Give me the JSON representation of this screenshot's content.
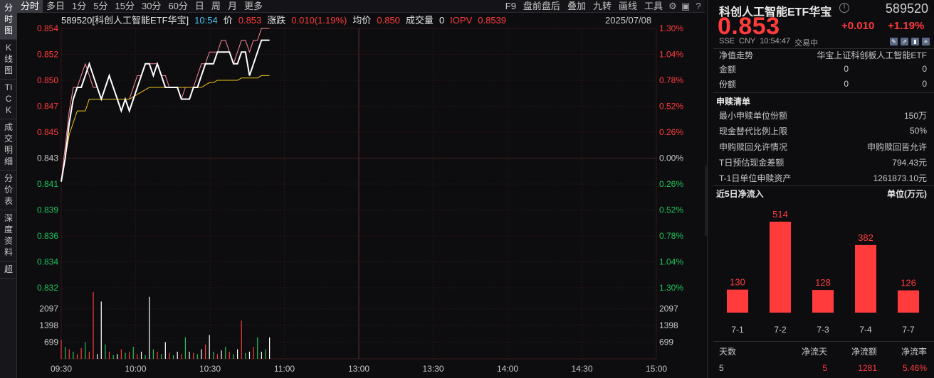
{
  "left_tabs": [
    "分时图",
    "K线图",
    "TICK",
    "成交明细",
    "分价表",
    "深度资料",
    "超"
  ],
  "toolbar": {
    "periods": [
      "分时",
      "多日",
      "1分",
      "5分",
      "15分",
      "30分",
      "60分",
      "日",
      "周",
      "月",
      "更多"
    ],
    "active_period": "分时",
    "right_items": [
      "F9",
      "盘前盘后",
      "叠加",
      "九转",
      "画线",
      "工具"
    ]
  },
  "info": {
    "code_name": "589520[科创人工智能ETF华宝]",
    "time": "10:54",
    "price_label": "价",
    "price": "0.853",
    "change_label": "涨跌",
    "change": "0.010(1.19%)",
    "avg_label": "均价",
    "avg": "0.850",
    "volume_label": "成交量",
    "volume": "0",
    "iopv_label": "IOPV",
    "iopv": "0.8539",
    "date": "2025/07/08"
  },
  "chart_data": {
    "type": "line",
    "y_price_ticks": [
      "0.854",
      "0.852",
      "0.850",
      "0.847",
      "0.845",
      "0.843",
      "0.841",
      "0.839",
      "0.836",
      "0.834",
      "0.832"
    ],
    "y_pct_ticks": [
      "1.30%",
      "1.04%",
      "0.78%",
      "0.52%",
      "0.26%",
      "0.00%",
      "0.26%",
      "0.52%",
      "0.78%",
      "1.04%",
      "1.30%"
    ],
    "volume_ticks": [
      "2097",
      "1398",
      "699"
    ],
    "x_ticks": [
      "09:30",
      "10:00",
      "10:30",
      "11:00",
      "13:00",
      "13:30",
      "14:00",
      "14:30",
      "15:00"
    ],
    "prev_close": 0.843,
    "price_series": [
      0.841,
      0.843,
      0.846,
      0.848,
      0.849,
      0.849,
      0.85,
      0.851,
      0.85,
      0.849,
      0.848,
      0.849,
      0.85,
      0.849,
      0.848,
      0.847,
      0.848,
      0.847,
      0.848,
      0.849,
      0.85,
      0.851,
      0.851,
      0.85,
      0.851,
      0.85,
      0.849,
      0.849,
      0.849,
      0.849,
      0.848,
      0.848,
      0.848,
      0.849,
      0.849,
      0.85,
      0.851,
      0.851,
      0.851,
      0.852,
      0.852,
      0.852,
      0.852,
      0.851,
      0.851,
      0.852,
      0.852,
      0.85,
      0.851,
      0.852,
      0.853,
      0.853,
      0.853
    ],
    "avg_series": [
      0.841,
      0.843,
      0.845,
      0.846,
      0.847,
      0.847,
      0.847,
      0.848,
      0.848,
      0.848,
      0.848,
      0.848,
      0.848,
      0.848,
      0.848,
      0.848,
      0.848,
      0.848,
      0.8482,
      0.8484,
      0.8486,
      0.8488,
      0.849,
      0.849,
      0.849,
      0.849,
      0.849,
      0.849,
      0.849,
      0.849,
      0.849,
      0.849,
      0.849,
      0.849,
      0.849,
      0.849,
      0.8492,
      0.8494,
      0.8494,
      0.8496,
      0.8496,
      0.8496,
      0.8496,
      0.8496,
      0.8496,
      0.8498,
      0.8498,
      0.8498,
      0.8498,
      0.8498,
      0.85,
      0.85,
      0.85
    ],
    "iopv_series": [
      0.841,
      0.844,
      0.847,
      0.849,
      0.849,
      0.85,
      0.851,
      0.85,
      0.849,
      0.849,
      0.848,
      0.849,
      0.85,
      0.849,
      0.848,
      0.848,
      0.848,
      0.848,
      0.849,
      0.85,
      0.85,
      0.851,
      0.851,
      0.851,
      0.851,
      0.85,
      0.85,
      0.849,
      0.849,
      0.849,
      0.848,
      0.849,
      0.849,
      0.849,
      0.85,
      0.851,
      0.851,
      0.852,
      0.852,
      0.852,
      0.853,
      0.853,
      0.852,
      0.851,
      0.852,
      0.853,
      0.853,
      0.852,
      0.853,
      0.853,
      0.854,
      0.854,
      0.854
    ],
    "volume_series": [
      800,
      500,
      400,
      300,
      200,
      450,
      700,
      300,
      2800,
      200,
      2400,
      600,
      300,
      150,
      200,
      400,
      250,
      300,
      500,
      200,
      300,
      150,
      2600,
      400,
      300,
      200,
      700,
      250,
      150,
      300,
      200,
      900,
      300,
      250,
      200,
      400,
      600,
      1000,
      300,
      200,
      350,
      500,
      300,
      200,
      400,
      1600,
      250,
      300,
      500,
      900,
      300,
      400,
      900
    ],
    "volume_colors": [
      "r",
      "g",
      "r",
      "g",
      "r",
      "r",
      "g",
      "r",
      "r",
      "w",
      "w",
      "g",
      "r",
      "g",
      "w",
      "r",
      "g",
      "r",
      "g",
      "r",
      "w",
      "g",
      "w",
      "g",
      "r",
      "g",
      "w",
      "r",
      "g",
      "w",
      "r",
      "g",
      "w",
      "r",
      "g",
      "w",
      "r",
      "w",
      "g",
      "r",
      "w",
      "g",
      "r",
      "g",
      "w",
      "r",
      "g",
      "w",
      "r",
      "g",
      "w",
      "g",
      "w"
    ],
    "colors": {
      "price": "#ffffff",
      "avg": "#f0c419",
      "iopv": "#ff8a9a",
      "up": "#ff3b3b",
      "down": "#1dc45a"
    }
  },
  "panel": {
    "title": "科创人工智能ETF华宝",
    "info_icon": "info-circle-icon",
    "code": "589520",
    "price": "0.853",
    "change": "+0.010",
    "change_pct": "+1.19%",
    "exchange": "SSE",
    "currency": "CNY",
    "time": "10:54:47",
    "status": "交易中",
    "nav_label": "净值走势",
    "nav_value": "华宝上证科创板人工智能ETF",
    "rows_top": [
      {
        "label": "金额",
        "v1": "0",
        "v2": "0"
      },
      {
        "label": "份额",
        "v1": "0",
        "v2": "0"
      }
    ],
    "redeem_title": "申赎清单",
    "redeem_rows": [
      {
        "label": "最小申赎单位份额",
        "value": "150万"
      },
      {
        "label": "现金替代比例上限",
        "value": "50%"
      },
      {
        "label": "申购赎回允许情况",
        "value": "申购赎回皆允许"
      },
      {
        "label": "T日预估现金差额",
        "value": "794.43元"
      },
      {
        "label": "T-1日单位申赎资产",
        "value": "1261873.10元"
      }
    ],
    "flow_title": "近5日净流入",
    "flow_unit": "单位(万元)",
    "flow_headers": [
      "天数",
      "净流天",
      "净流额",
      "净流率"
    ],
    "flow_summary": [
      "5",
      "5",
      "1281",
      "5.46%"
    ]
  },
  "flow_chart": {
    "type": "bar",
    "categories": [
      "7-1",
      "7-2",
      "7-3",
      "7-4",
      "7-7"
    ],
    "values": [
      130,
      514,
      128,
      382,
      126
    ],
    "value_labels": [
      "130",
      "514",
      "128",
      "382",
      "126"
    ],
    "color": "#ff3b3b"
  }
}
